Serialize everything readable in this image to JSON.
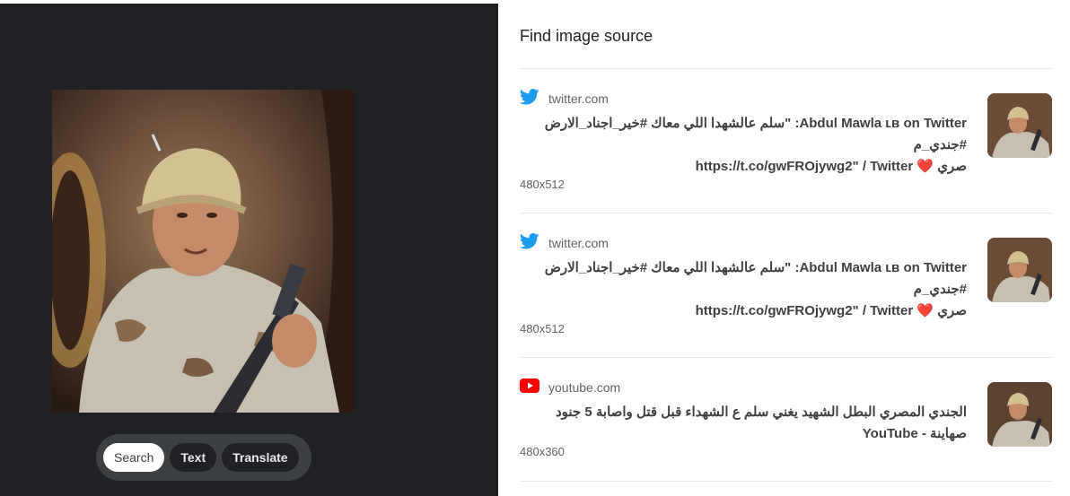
{
  "controls": {
    "search_label": "Search",
    "text_label": "Text",
    "translate_label": "Translate"
  },
  "panel": {
    "heading": "Find image source"
  },
  "results": [
    {
      "source_icon": "twitter-bird-icon",
      "source": "twitter.com",
      "title_line1": "Abdul Mawla ʟʙ on Twitter: \"سلم عالشهدا اللي معاك #خير_اجناد_الارض #جندي_م",
      "title_line2": "صري ❤️ https://t.co/gwFROjywg2\" / Twitter",
      "dimensions": "480x512"
    },
    {
      "source_icon": "twitter-bird-icon",
      "source": "twitter.com",
      "title_line1": "Abdul Mawla ʟʙ on Twitter: \"سلم عالشهدا اللي معاك #خير_اجناد_الارض #جندي_م",
      "title_line2": "صري ❤️ https://t.co/gwFROjywg2\" / Twitter",
      "dimensions": "480x512"
    },
    {
      "source_icon": "youtube-play-icon",
      "source": "youtube.com",
      "title_line1": "الجندي المصري البطل الشهيد يغني سلم ع الشهداء قبل قتل واصابة 5 جنود صهاينة - YouTube",
      "title_line2": "",
      "dimensions": "480x360"
    }
  ],
  "colors": {
    "twitter_blue": "#1d9bf0",
    "youtube_red": "#ff0000",
    "dark_bg": "#202124"
  }
}
